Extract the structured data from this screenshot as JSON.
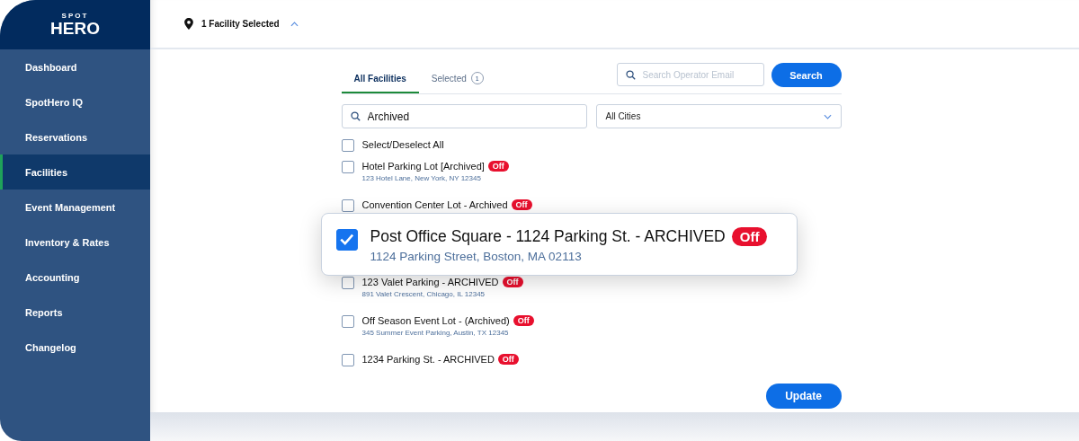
{
  "logo": {
    "top": "SPOT",
    "bottom": "HERO"
  },
  "sidebar": {
    "items": [
      {
        "label": "Dashboard",
        "selected": false
      },
      {
        "label": "SpotHero IQ",
        "selected": false
      },
      {
        "label": "Reservations",
        "selected": false
      },
      {
        "label": "Facilities",
        "selected": true
      },
      {
        "label": "Event Management",
        "selected": false
      },
      {
        "label": "Inventory & Rates",
        "selected": false
      },
      {
        "label": "Accounting",
        "selected": false
      },
      {
        "label": "Reports",
        "selected": false
      },
      {
        "label": "Changelog",
        "selected": false
      }
    ]
  },
  "header": {
    "facility_selector": "1 Facility Selected",
    "expanded": true
  },
  "tabs": [
    {
      "label": "All Facilities",
      "selected": true
    },
    {
      "label": "Selected",
      "count": "1",
      "selected": false
    }
  ],
  "operator_search": {
    "placeholder": "Search Operator Email",
    "button": "Search"
  },
  "facility_search": {
    "value": "Archived"
  },
  "city_filter": {
    "value": "All Cities"
  },
  "select_all": {
    "label": "Select/Deselect All",
    "checked": false
  },
  "facilities": [
    {
      "kind": "row",
      "name": "Hotel Parking Lot [Archived]",
      "status": "Off",
      "address": "123 Hotel Lane, New York, NY 12345",
      "checked": false
    },
    {
      "kind": "row",
      "name": "Convention Center Lot - Archived",
      "status": "Off",
      "checked": false
    },
    {
      "kind": "popup",
      "name": "Post Office Square - 1124 Parking St. - ARCHIVED",
      "status": "Off",
      "address": "1124 Parking Street, Boston, MA 02113",
      "checked": true
    },
    {
      "kind": "row",
      "name": "123 Valet Parking - ARCHIVED",
      "status": "Off",
      "address": "891 Valet Crescent, Chicago, IL 12345",
      "checked": false
    },
    {
      "kind": "row",
      "name": "Off Season Event Lot - (Archived)",
      "status": "Off",
      "address": "345 Summer Event Parking, Austin, TX 12345",
      "checked": false
    },
    {
      "kind": "row",
      "name": "1234 Parking St. - ARCHIVED",
      "status": "Off",
      "checked": false
    }
  ],
  "update_button": "Update"
}
